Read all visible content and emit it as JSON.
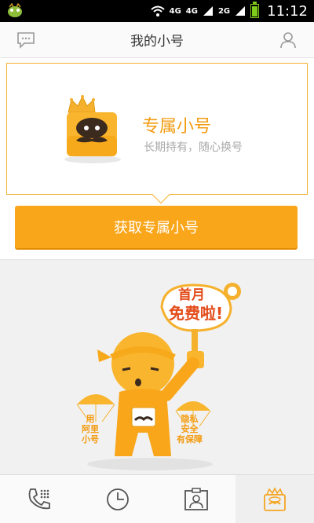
{
  "status_bar": {
    "time": "11:12",
    "network_1": "4G",
    "network_2": "4G",
    "network_3": "2G"
  },
  "header": {
    "title": "我的小号"
  },
  "promo_card": {
    "title": "专属小号",
    "subtitle": "长期持有，随心换号"
  },
  "action": {
    "get_number_label": "获取专属小号"
  },
  "illustration": {
    "speech_line1": "首月",
    "speech_line2": "免费啦!",
    "left_parachute_text": "用\n阿里\n小号",
    "right_parachute_text": "隐私\n安全\n有保障"
  },
  "bottom_nav": {
    "tabs": [
      {
        "name": "dialer",
        "active": false
      },
      {
        "name": "history",
        "active": false
      },
      {
        "name": "contacts",
        "active": false
      },
      {
        "name": "my-number",
        "active": true
      }
    ]
  },
  "colors": {
    "accent": "#f9a61b",
    "title_orange": "#f39c12",
    "speech_red": "#e34b1a"
  }
}
